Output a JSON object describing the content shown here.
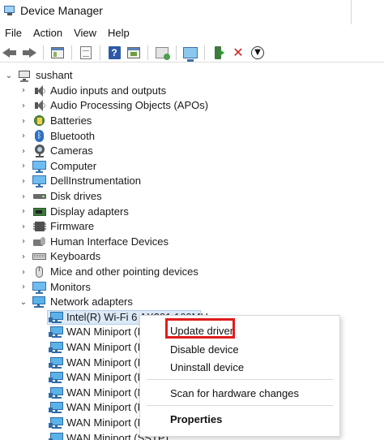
{
  "window": {
    "title": "Device Manager"
  },
  "menu": [
    "File",
    "Action",
    "View",
    "Help"
  ],
  "toolbar": {
    "icons": [
      "back-arrow-icon",
      "forward-arrow-icon",
      "show-hide-console-tree-icon",
      "export-list-icon",
      "help-icon",
      "properties-icon",
      "scan-hardware-icon",
      "monitor-icon",
      "update-driver-icon",
      "uninstall-icon",
      "download-icon"
    ],
    "accent_red": "#d01f1f"
  },
  "tree": {
    "root": "sushant",
    "categories": [
      {
        "label": "Audio inputs and outputs",
        "icon": "speaker-icon"
      },
      {
        "label": "Audio Processing Objects (APOs)",
        "icon": "speaker-icon"
      },
      {
        "label": "Batteries",
        "icon": "battery-icon"
      },
      {
        "label": "Bluetooth",
        "icon": "bluetooth-icon"
      },
      {
        "label": "Cameras",
        "icon": "camera-icon"
      },
      {
        "label": "Computer",
        "icon": "monitor-icon"
      },
      {
        "label": "DellInstrumentation",
        "icon": "monitor-icon"
      },
      {
        "label": "Disk drives",
        "icon": "disk-icon"
      },
      {
        "label": "Display adapters",
        "icon": "display-adapter-icon"
      },
      {
        "label": "Firmware",
        "icon": "chip-icon"
      },
      {
        "label": "Human Interface Devices",
        "icon": "hid-icon"
      },
      {
        "label": "Keyboards",
        "icon": "keyboard-icon"
      },
      {
        "label": "Mice and other pointing devices",
        "icon": "mouse-icon"
      },
      {
        "label": "Monitors",
        "icon": "monitor-icon"
      },
      {
        "label": "Network adapters",
        "icon": "network-icon"
      }
    ],
    "network_children": [
      "Intel(R) Wi-Fi 6 AX201 160MHz",
      "WAN Miniport (I",
      "WAN Miniport (I",
      "WAN Miniport (I",
      "WAN Miniport (L",
      "WAN Miniport (N",
      "WAN Miniport (F",
      "WAN Miniport (F",
      "WAN Miniport (SSTP)"
    ]
  },
  "context_menu": {
    "items": [
      "Update driver",
      "Disable device",
      "Uninstall device",
      "Scan for hardware changes",
      "Properties"
    ],
    "highlight_color": "#e01c1c"
  }
}
